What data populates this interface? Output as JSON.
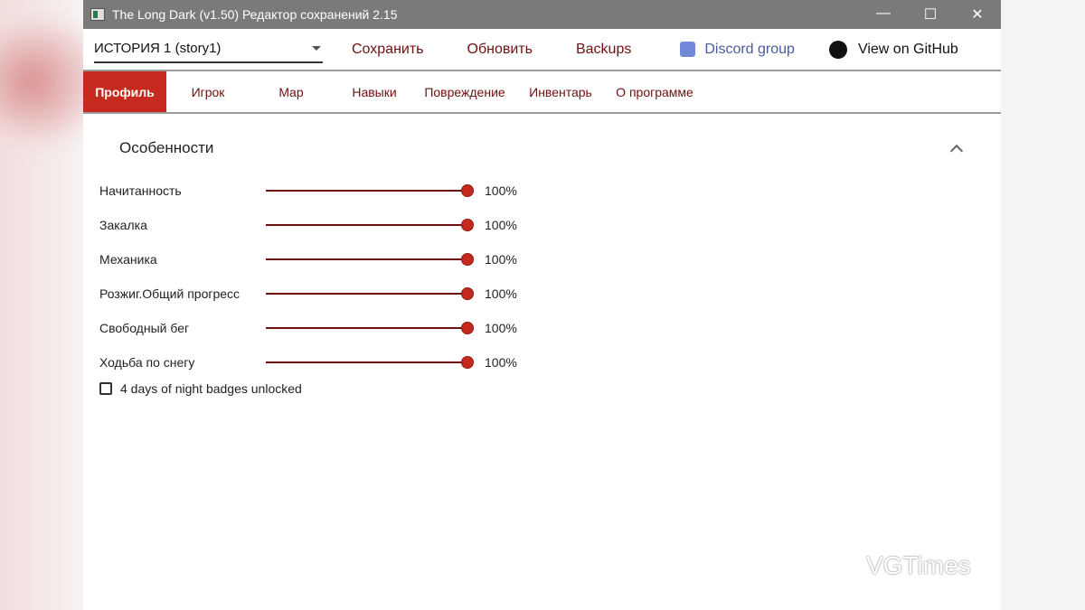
{
  "window": {
    "title": "The Long Dark (v1.50) Редактор сохранений 2.15"
  },
  "toolbar": {
    "save_select": "ИСТОРИЯ 1 (story1)",
    "save": "Сохранить",
    "refresh": "Обновить",
    "backups": "Backups",
    "discord": "Discord group",
    "github": "View on GitHub"
  },
  "tabs": [
    "Профиль",
    "Игрок",
    "Map",
    "Навыки",
    "Повреждение",
    "Инвентарь",
    "О программе"
  ],
  "section": {
    "title": "Особенности",
    "feats": [
      {
        "label": "Начитанность",
        "value": "100%"
      },
      {
        "label": "Закалка",
        "value": "100%"
      },
      {
        "label": "Механика",
        "value": "100%"
      },
      {
        "label": "Розжиг.Общий прогресс",
        "value": "100%"
      },
      {
        "label": "Свободный бег",
        "value": "100%"
      },
      {
        "label": "Ходьба по снегу",
        "value": "100%"
      }
    ],
    "checkbox": {
      "label": "4 days of night badges unlocked",
      "checked": false
    }
  },
  "watermark": "VGTimes",
  "colors": {
    "accent": "#c62a1e",
    "text_link": "#6e1010",
    "discord": "#7289da"
  }
}
